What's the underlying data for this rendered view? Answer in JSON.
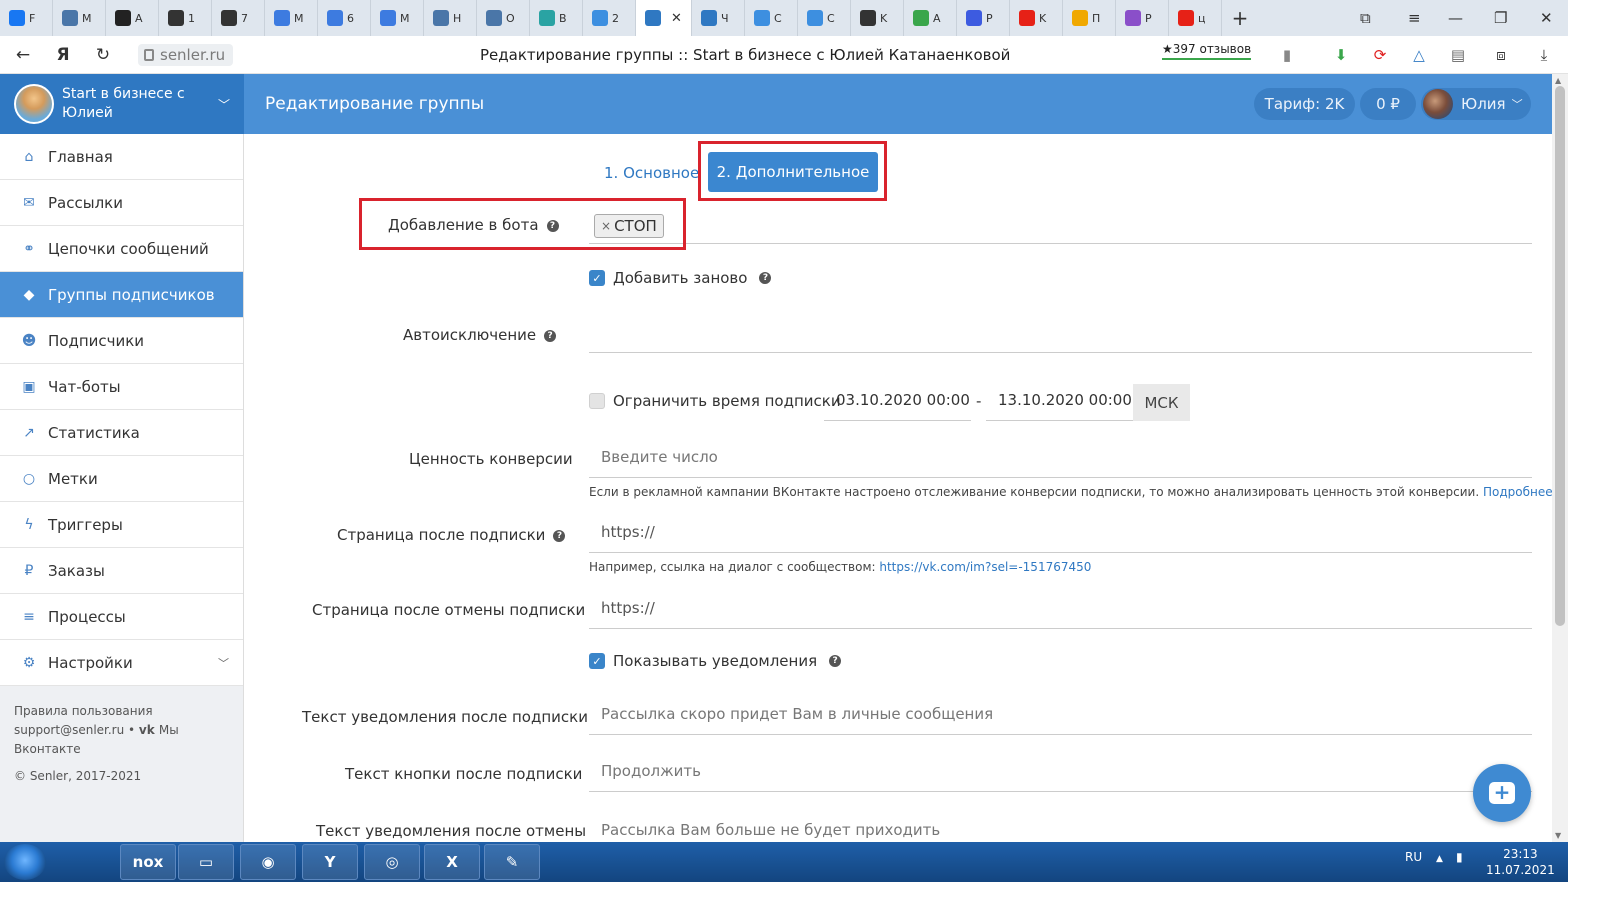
{
  "browser": {
    "tabs": [
      {
        "label": "F",
        "icon": "facebook-icon",
        "color": "#1877f2"
      },
      {
        "label": "M",
        "icon": "vk-icon",
        "color": "#4a76a8"
      },
      {
        "label": "A",
        "icon": "app-icon",
        "color": "#222222"
      },
      {
        "label": "1",
        "icon": "gc-icon",
        "color": "#333333"
      },
      {
        "label": "7",
        "icon": "gc-icon",
        "color": "#333333"
      },
      {
        "label": "M",
        "icon": "app-icon",
        "color": "#3d7be0"
      },
      {
        "label": "6",
        "icon": "app-icon",
        "color": "#3d7be0"
      },
      {
        "label": "M",
        "icon": "app-icon",
        "color": "#3d7be0"
      },
      {
        "label": "H",
        "icon": "vk-icon",
        "color": "#4a76a8"
      },
      {
        "label": "O",
        "icon": "vk-icon",
        "color": "#4a76a8"
      },
      {
        "label": "B",
        "icon": "app-icon",
        "color": "#2aa3a3"
      },
      {
        "label": "2",
        "icon": "chat-icon",
        "color": "#3d8fe0"
      },
      {
        "label": "",
        "icon": "senler-icon",
        "color": "#2f78c2",
        "active": true
      },
      {
        "label": "Ч",
        "icon": "senler-icon",
        "color": "#2f78c2"
      },
      {
        "label": "C",
        "icon": "chat-icon",
        "color": "#3d8fe0"
      },
      {
        "label": "C",
        "icon": "chat-icon",
        "color": "#3d8fe0"
      },
      {
        "label": "K",
        "icon": "circle-icon",
        "color": "#333333"
      },
      {
        "label": "A",
        "icon": "check-icon",
        "color": "#3aa64b"
      },
      {
        "label": "P",
        "icon": "app-icon",
        "color": "#3d5be0"
      },
      {
        "label": "K",
        "icon": "youtube-icon",
        "color": "#e62117"
      },
      {
        "label": "П",
        "icon": "mail-icon",
        "color": "#f0a800"
      },
      {
        "label": "P",
        "icon": "app-icon",
        "color": "#8a4fc9"
      },
      {
        "label": "ц",
        "icon": "yandex-icon",
        "color": "#e62117"
      }
    ],
    "url": "senler.ru",
    "page_title": "Редактирование группы :: Start в бизнесе с Юлией Катанаенковой",
    "reviews": "★397 отзывов"
  },
  "header": {
    "brand_name": "Start в бизнесе с Юлией",
    "title": "Редактирование группы",
    "tariff": "Тариф: 2K",
    "balance": "0 ₽",
    "user": "Юлия"
  },
  "sidebar": {
    "items": [
      {
        "label": "Главная",
        "icon": "home-icon",
        "glyph": "⌂"
      },
      {
        "label": "Рассылки",
        "icon": "envelope-icon",
        "glyph": "✉"
      },
      {
        "label": "Цепочки сообщений",
        "icon": "link-icon",
        "glyph": "⚭"
      },
      {
        "label": "Группы подписчиков",
        "icon": "tags-icon",
        "glyph": "◆",
        "active": true
      },
      {
        "label": "Подписчики",
        "icon": "users-icon",
        "glyph": "☻"
      },
      {
        "label": "Чат-боты",
        "icon": "android-icon",
        "glyph": "▣"
      },
      {
        "label": "Статистика",
        "icon": "chart-icon",
        "glyph": "↗"
      },
      {
        "label": "Метки",
        "icon": "circle-icon",
        "glyph": "○"
      },
      {
        "label": "Триггеры",
        "icon": "bolt-icon",
        "glyph": "ϟ"
      },
      {
        "label": "Заказы",
        "icon": "ruble-icon",
        "glyph": "₽"
      },
      {
        "label": "Процессы",
        "icon": "tasks-icon",
        "glyph": "≡"
      },
      {
        "label": "Настройки",
        "icon": "cogs-icon",
        "glyph": "⚙"
      }
    ],
    "footer_rules": "Правила пользования",
    "footer_support": "support@senler.ru • ",
    "footer_vk": "Мы Вконтакте",
    "footer_copy": "© Senler, 2017-2021"
  },
  "steps": {
    "step1": "1. Основное",
    "step2": "2. Дополнительное"
  },
  "form": {
    "add_to_bot_label": "Добавление в бота",
    "add_to_bot_tag": "СТОП",
    "re_add_label": "Добавить заново",
    "auto_exclude_label": "Автоисключение",
    "limit_time_label": "Ограничить время подписки",
    "date_from": "03.10.2020 00:00",
    "date_sep": "-",
    "date_to": "13.10.2020 00:00",
    "tz": "МСК",
    "conversion_label": "Ценность конверсии",
    "conversion_placeholder": "Введите число",
    "conversion_hint": "Если в рекламной кампании ВКонтакте настроено отслеживание конверсии подписки, то можно анализировать ценность этой конверсии.",
    "conversion_hint_link": "Подробнее",
    "after_sub_label": "Страница после подписки",
    "after_sub_value": "https://",
    "after_sub_hint": "Например, ссылка на диалог с сообществом:",
    "after_sub_hint_link": "https://vk.com/im?sel=-151767450",
    "after_unsub_label": "Страница после отмены подписки",
    "after_unsub_value": "https://",
    "show_notif_label": "Показывать уведомления",
    "notif_after_sub_label": "Текст уведомления после подписки",
    "notif_after_sub_placeholder": "Рассылка скоро придет Вам в личные сообщения",
    "button_after_sub_label": "Текст кнопки после подписки",
    "button_after_sub_placeholder": "Продолжить",
    "notif_after_unsub_label": "Текст уведомления после отмены",
    "notif_after_unsub_placeholder": "Рассылка Вам больше не будет приходить"
  },
  "taskbar": {
    "apps": [
      "nox-icon",
      "explorer-icon",
      "chrome-icon",
      "yandex-browser-icon",
      "photo-app-icon",
      "excel-icon",
      "paint-icon"
    ],
    "lang": "RU",
    "time": "23:13",
    "date": "11.07.2021"
  },
  "colors": {
    "accent": "#4a90d6",
    "brand_dark": "#2f78c2",
    "highlight_red": "#d9232d"
  }
}
